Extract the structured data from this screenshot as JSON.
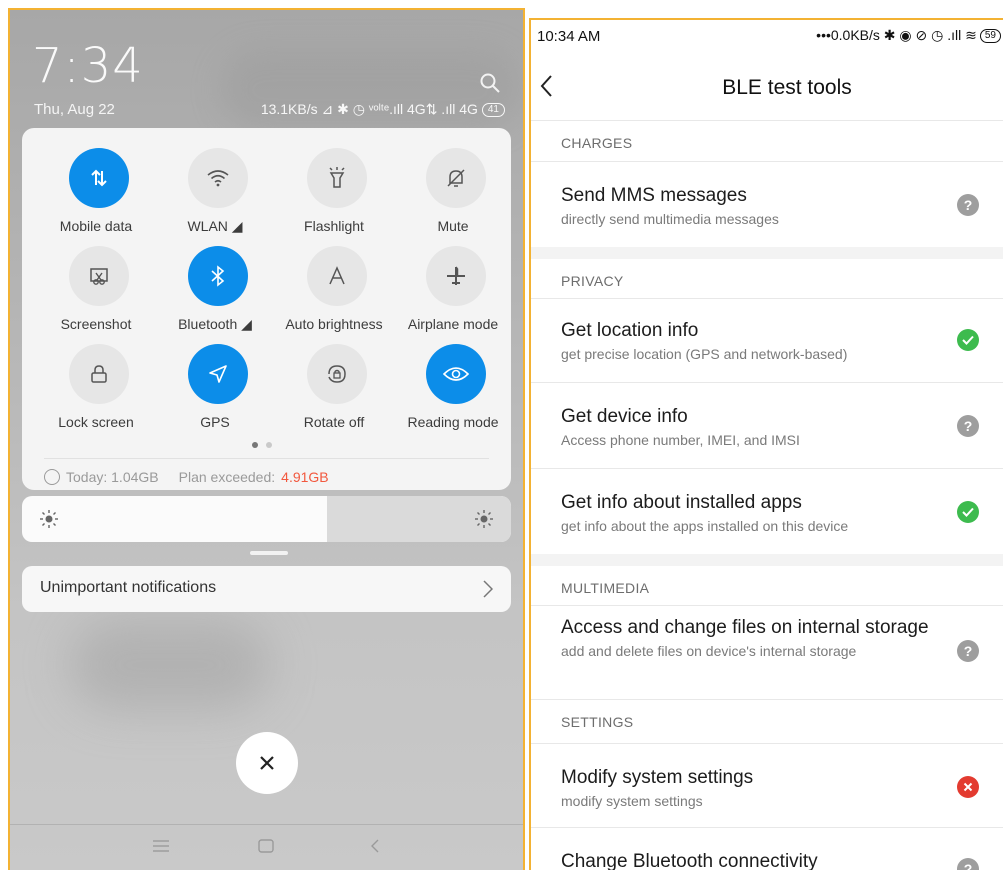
{
  "left_phone": {
    "time": "7:34",
    "date": "Thu, Aug 22",
    "status_text": "13.1KB/s ⊿ ✱ ◷ ᵛᵒˡᵗᵉ.ıll 4G⇅ .ıll 4G",
    "battery": "41",
    "tiles": [
      {
        "label": "Mobile data",
        "icon": "mobile-data-icon",
        "active": true
      },
      {
        "label": "WLAN ◢",
        "icon": "wifi-icon",
        "active": false
      },
      {
        "label": "Flashlight",
        "icon": "flashlight-icon",
        "active": false
      },
      {
        "label": "Mute",
        "icon": "mute-bell-icon",
        "active": false
      },
      {
        "label": "Screenshot",
        "icon": "screenshot-icon",
        "active": false
      },
      {
        "label": "Bluetooth ◢",
        "icon": "bluetooth-icon",
        "active": true
      },
      {
        "label": "Auto brightness",
        "icon": "auto-brightness-icon",
        "active": false
      },
      {
        "label": "Airplane mode",
        "icon": "airplane-icon",
        "active": false
      },
      {
        "label": "Lock screen",
        "icon": "lock-icon",
        "active": false
      },
      {
        "label": "GPS",
        "icon": "gps-arrow-icon",
        "active": true
      },
      {
        "label": "Rotate off",
        "icon": "rotate-lock-icon",
        "active": false
      },
      {
        "label": "Reading mode",
        "icon": "eye-icon",
        "active": true
      }
    ],
    "usage": {
      "today": "Today: 1.04GB",
      "plan_label": "Plan exceeded:",
      "plan_value": "4.91GB"
    },
    "notification": "Unimportant notifications",
    "colors": {
      "accent": "#0c8de9",
      "warning": "#f2583e"
    }
  },
  "right_phone": {
    "status_time": "10:34 AM",
    "status_icons": "•••0.0KB/s ✱ ◉ ⊘ ◷ .ıll ≋",
    "battery": "59",
    "title": "BLE test tools",
    "sections": [
      {
        "header": "CHARGES",
        "items": [
          {
            "title": "Send MMS messages",
            "desc": "directly send multimedia messages",
            "status": "?"
          }
        ]
      },
      {
        "header": "PRIVACY",
        "items": [
          {
            "title": "Get location info",
            "desc": "get precise location (GPS and network-based)",
            "status": "allowed"
          },
          {
            "title": "Get device info",
            "desc": "Access phone number, IMEI, and IMSI",
            "status": "?"
          },
          {
            "title": "Get info about installed apps",
            "desc": "get info about the apps installed on this device",
            "status": "allowed"
          }
        ]
      },
      {
        "header": "MULTIMEDIA",
        "items": [
          {
            "title": "Access and change files on internal storage",
            "desc": "add and delete files on device's internal storage",
            "status": "?"
          }
        ]
      },
      {
        "header": "SETTINGS",
        "items": [
          {
            "title": "Modify system settings",
            "desc": "modify system settings",
            "status": "denied"
          },
          {
            "title": "Change Bluetooth connectivity",
            "desc": "",
            "status": "?"
          }
        ]
      }
    ],
    "colors": {
      "allowed": "#3dbb4e",
      "denied": "#e33b30",
      "unknown": "#9e9e9e"
    }
  }
}
